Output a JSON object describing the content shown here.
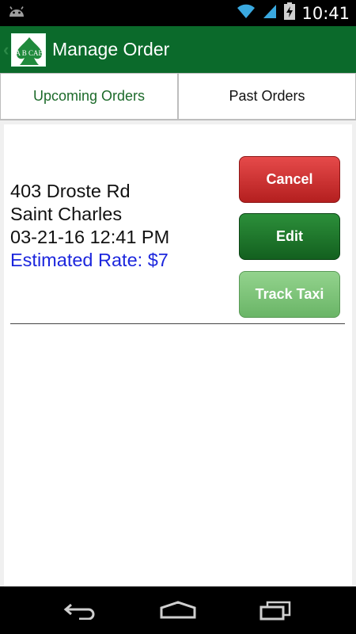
{
  "status_bar": {
    "time": "10:41",
    "icons": [
      "android-icon",
      "wifi-icon",
      "signal-icon",
      "battery-charging-icon"
    ]
  },
  "action_bar": {
    "title": "Manage Order",
    "logo_text": "A B CAB",
    "color": "#0b6a2b"
  },
  "tabs": [
    {
      "label": "Upcoming Orders",
      "active": true
    },
    {
      "label": "Past Orders",
      "active": false
    }
  ],
  "order": {
    "address": "403 Droste Rd",
    "city": "Saint Charles",
    "datetime": "03-21-16 12:41 PM",
    "rate": "Estimated Rate: $7"
  },
  "buttons": {
    "cancel": "Cancel",
    "edit": "Edit",
    "track": "Track Taxi"
  },
  "nav_bar": {
    "icons": [
      "back-icon",
      "home-icon",
      "recent-apps-icon"
    ]
  }
}
